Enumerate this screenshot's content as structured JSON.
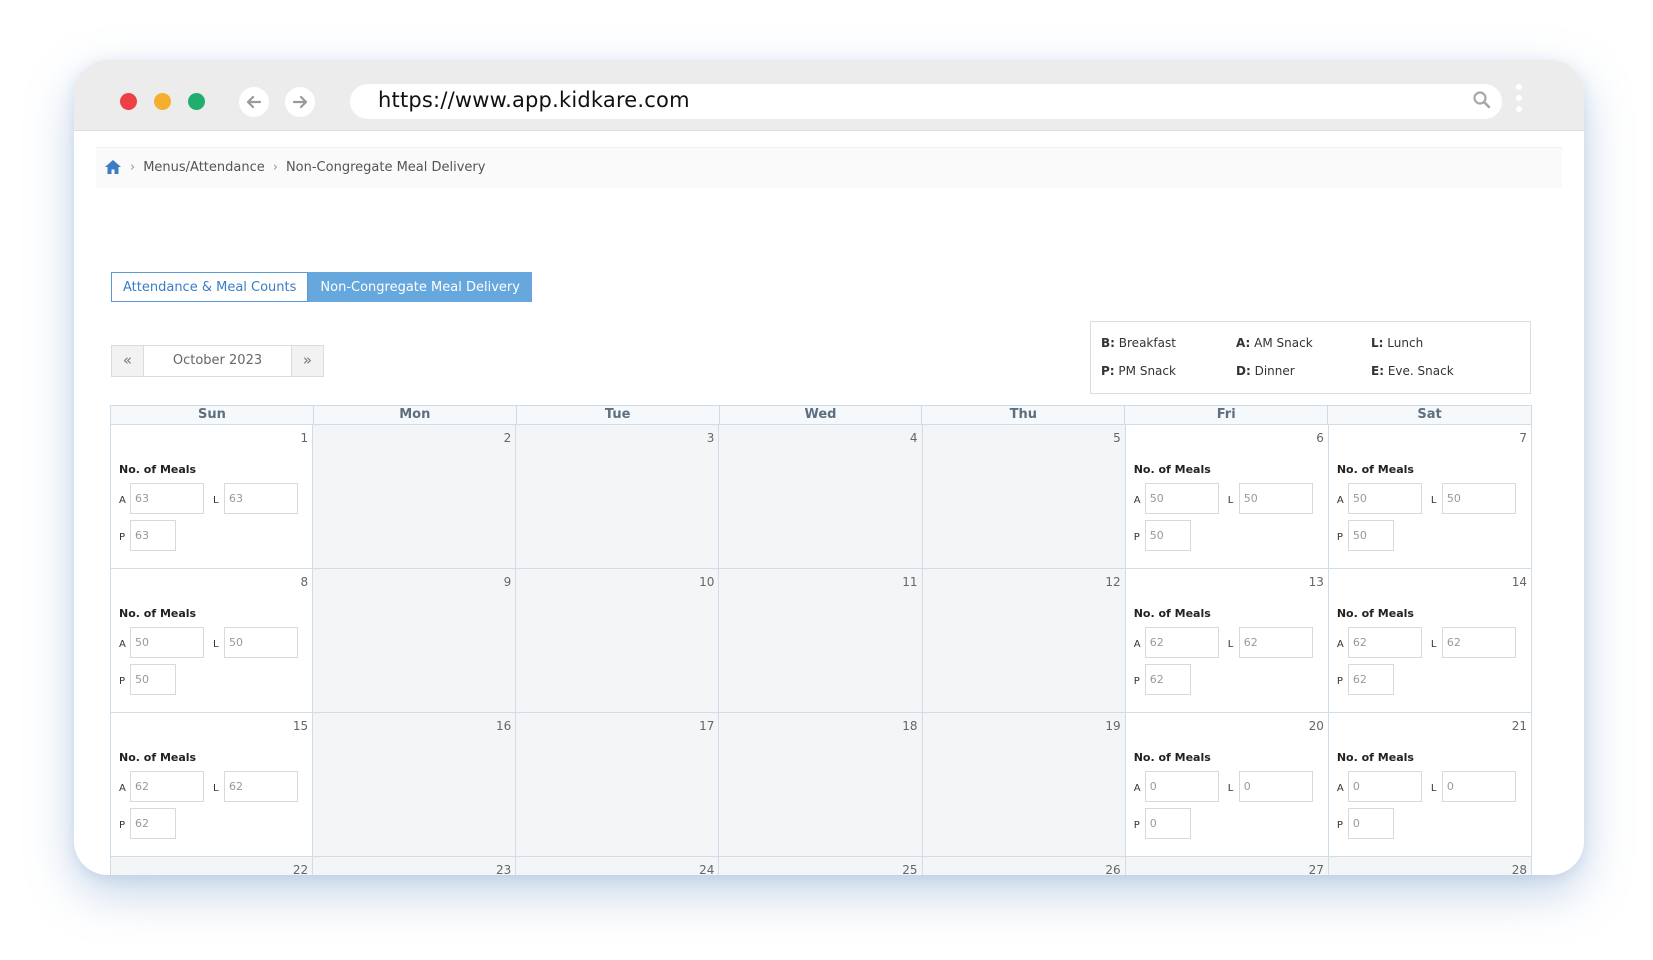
{
  "browser": {
    "url": "https://www.app.kidkare.com"
  },
  "breadcrumb": {
    "items": [
      "Menus/Attendance",
      "Non-Congregate Meal Delivery"
    ],
    "separator": "›"
  },
  "tabs": [
    {
      "label": "Attendance & Meal Counts",
      "active": false
    },
    {
      "label": "Non-Congregate Meal Delivery",
      "active": true
    }
  ],
  "month_nav": {
    "prev": "«",
    "month": "October 2023",
    "next": "»"
  },
  "legend": [
    {
      "code": "B:",
      "label": "Breakfast"
    },
    {
      "code": "A:",
      "label": "AM Snack"
    },
    {
      "code": "L:",
      "label": "Lunch"
    },
    {
      "code": "P:",
      "label": "PM Snack"
    },
    {
      "code": "D:",
      "label": "Dinner"
    },
    {
      "code": "E:",
      "label": "Eve. Snack"
    }
  ],
  "calendar": {
    "weekdays": [
      "Sun",
      "Mon",
      "Tue",
      "Wed",
      "Thu",
      "Fri",
      "Sat"
    ],
    "meals_label": "No. of Meals",
    "field_codes": {
      "a": "A",
      "l": "L",
      "p": "P"
    },
    "days": [
      {
        "day": "1",
        "meals": {
          "A": "63",
          "L": "63",
          "P": "63"
        }
      },
      {
        "day": "2"
      },
      {
        "day": "3"
      },
      {
        "day": "4"
      },
      {
        "day": "5"
      },
      {
        "day": "6",
        "meals": {
          "A": "50",
          "L": "50",
          "P": "50"
        }
      },
      {
        "day": "7",
        "meals": {
          "A": "50",
          "L": "50",
          "P": "50"
        }
      },
      {
        "day": "8",
        "meals": {
          "A": "50",
          "L": "50",
          "P": "50"
        }
      },
      {
        "day": "9"
      },
      {
        "day": "10"
      },
      {
        "day": "11"
      },
      {
        "day": "12"
      },
      {
        "day": "13",
        "meals": {
          "A": "62",
          "L": "62",
          "P": "62"
        }
      },
      {
        "day": "14",
        "meals": {
          "A": "62",
          "L": "62",
          "P": "62"
        }
      },
      {
        "day": "15",
        "meals": {
          "A": "62",
          "L": "62",
          "P": "62"
        }
      },
      {
        "day": "16"
      },
      {
        "day": "17"
      },
      {
        "day": "18"
      },
      {
        "day": "19"
      },
      {
        "day": "20",
        "meals": {
          "A": "0",
          "L": "0",
          "P": "0"
        }
      },
      {
        "day": "21",
        "meals": {
          "A": "0",
          "L": "0",
          "P": "0"
        }
      },
      {
        "day": "22"
      },
      {
        "day": "23"
      },
      {
        "day": "24"
      },
      {
        "day": "25"
      },
      {
        "day": "26"
      },
      {
        "day": "27"
      },
      {
        "day": "28"
      }
    ]
  },
  "colors": {
    "accent": "#66a7de",
    "accent_text": "#3b7dc4",
    "traffic_red": "#ec3f46",
    "traffic_yellow": "#f6ae2e",
    "traffic_green": "#1fae6f"
  }
}
